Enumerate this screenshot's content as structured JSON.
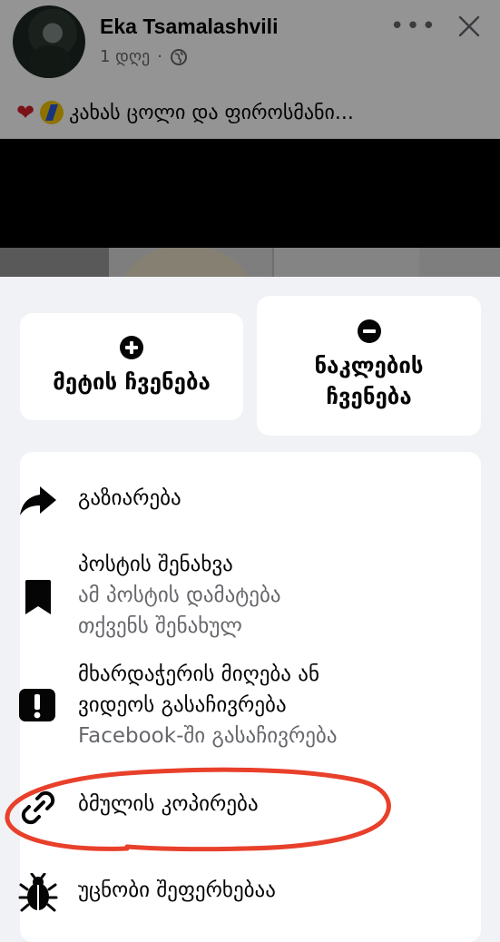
{
  "post": {
    "author": "Eka Tsamalashvili",
    "time": "1 დღე",
    "separator": "·",
    "caption": "კახას ცოლი და ფიროსმანი..."
  },
  "icons": {
    "globe": "globe-icon",
    "more": "more-horizontal-icon",
    "close": "close-icon",
    "heart": "red-heart-emoji",
    "badge": "yellow-lightning-badge-emoji"
  },
  "actions": {
    "show_more": {
      "label": "მეტის ჩვენება",
      "icon": "plus-circle-icon"
    },
    "show_less": {
      "label_line1": "ნაკლების",
      "label_line2": "ჩვენება",
      "icon": "minus-circle-icon"
    }
  },
  "menu": {
    "share": {
      "label": "გაზიარება",
      "icon": "share-arrow-icon"
    },
    "save": {
      "label": "პოსტის შენახვა",
      "sub1": "ამ პოსტის დამატება",
      "sub2": "თქვენს შენახულ",
      "icon": "bookmark-icon"
    },
    "report": {
      "label1": "მხარდაჭერის მიღება ან",
      "label2": "ვიდეოს გასაჩივრება",
      "sub": "Facebook-ში გასაჩივრება",
      "icon": "exclamation-square-icon"
    },
    "copy_link": {
      "label": "ბმულის კოპირება",
      "icon": "link-icon"
    },
    "bug": {
      "label": "უცნობი შეფერხებაა",
      "icon": "bug-icon"
    }
  },
  "colors": {
    "annotation": "#e8402b",
    "background": "#f0f2f5",
    "secondary_text": "#65676b"
  }
}
